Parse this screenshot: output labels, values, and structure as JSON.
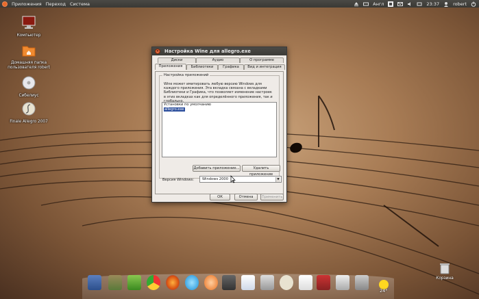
{
  "top_panel": {
    "menus": [
      "Приложения",
      "Переход",
      "Система"
    ],
    "keyboard_layout": "Англ",
    "time": "23:37",
    "user": "robert"
  },
  "desktop_icons": [
    {
      "label": "Компьютер",
      "icon": "computer-icon"
    },
    {
      "label": "Домашняя папка пользователя robert",
      "icon": "home-folder-icon"
    },
    {
      "label": "Сибелиус",
      "icon": "cd-icon"
    },
    {
      "label": "Finale Allegro 2007",
      "icon": "finale-icon"
    }
  ],
  "window": {
    "title": "Настройка Wine для allegro.exe",
    "tabs_row1": [
      "Диски",
      "Аудио",
      "О программе"
    ],
    "tabs_row2": [
      "Приложения",
      "Библиотеки",
      "Графика",
      "Вид и интеграция"
    ],
    "group_title": "Настройка приложений",
    "description": "Wine может имитировать любую версию Windows для каждого приложения. Эта вкладка связана с вкладками Библиотеки и Графика, что позволяет изменение настроек в этих вкладках как для определённого приложения, так и глобально.",
    "app_list": [
      "Установки по умолчанию",
      "allegro.exe"
    ],
    "selected_app": "allegro.exe",
    "add_button": "Добавить приложение...",
    "remove_button": "Удалить приложение",
    "windows_version_label": "Версия Windows:",
    "windows_version_value": "Windows 2000",
    "ok_button": "ОК",
    "cancel_button": "Отмена",
    "apply_button": "Применить"
  },
  "dock": {
    "weather_temp": "24°"
  },
  "trash_label": "Корзина"
}
